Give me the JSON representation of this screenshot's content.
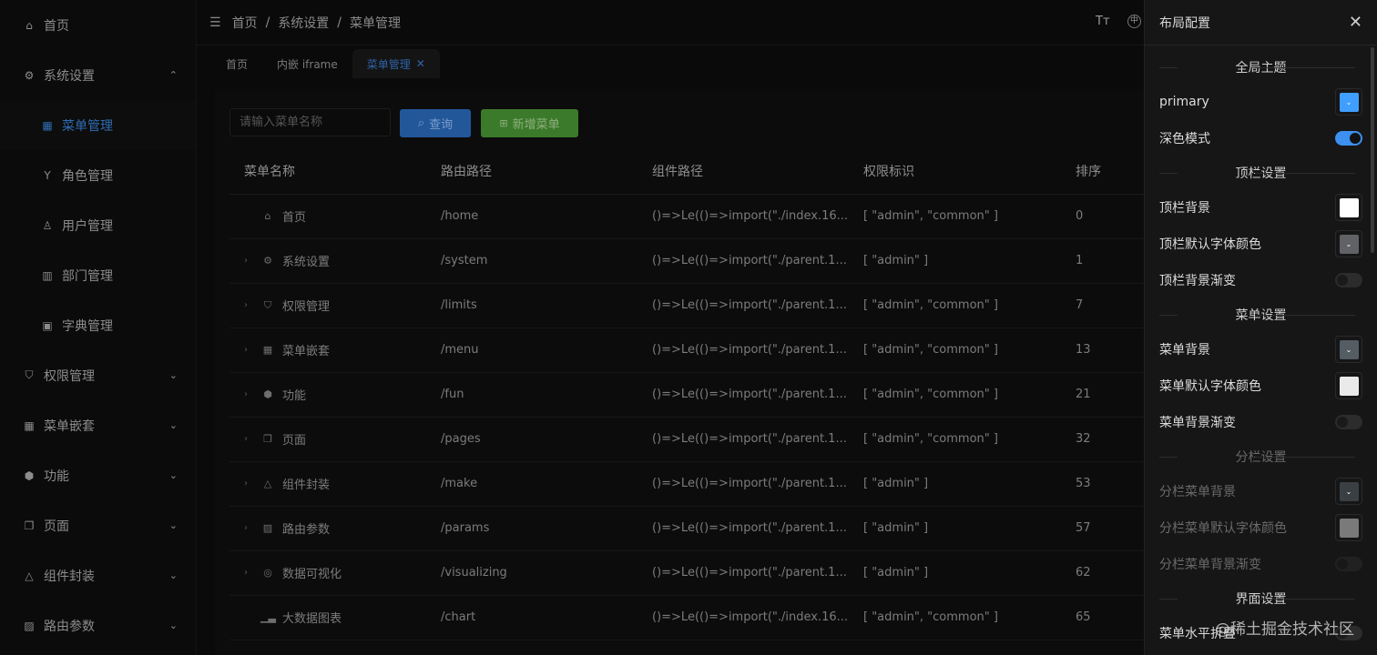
{
  "sidebar": {
    "items": [
      {
        "label": "首页",
        "icon": "home-icon",
        "glyph": "⌂"
      },
      {
        "label": "系统设置",
        "icon": "gear-icon",
        "glyph": "⚙",
        "arrow": "⌃"
      },
      {
        "label": "菜单管理",
        "icon": "grid-icon",
        "glyph": "▦",
        "sub": true,
        "active": true
      },
      {
        "label": "角色管理",
        "icon": "cocktail-icon",
        "glyph": "Y",
        "sub": true
      },
      {
        "label": "用户管理",
        "icon": "user-icon",
        "glyph": "♙",
        "sub": true
      },
      {
        "label": "部门管理",
        "icon": "building-icon",
        "glyph": "▥",
        "sub": true
      },
      {
        "label": "字典管理",
        "icon": "dictionary-icon",
        "glyph": "▣",
        "sub": true
      },
      {
        "label": "权限管理",
        "icon": "shield-icon",
        "glyph": "⛉",
        "arrow": "⌄"
      },
      {
        "label": "菜单嵌套",
        "icon": "grid-icon",
        "glyph": "▦",
        "arrow": "⌄"
      },
      {
        "label": "功能",
        "icon": "cube-icon",
        "glyph": "⬢",
        "arrow": "⌄"
      },
      {
        "label": "页面",
        "icon": "copy-icon",
        "glyph": "❐",
        "arrow": "⌄"
      },
      {
        "label": "组件封装",
        "icon": "shapes-icon",
        "glyph": "△",
        "arrow": "⌄"
      },
      {
        "label": "路由参数",
        "icon": "image-icon",
        "glyph": "▨",
        "arrow": "⌄"
      }
    ]
  },
  "header": {
    "breadcrumb": [
      "首页",
      "系统设置",
      "菜单管理"
    ],
    "separator": "/",
    "menu_icon": "☰",
    "font_icon": "Tт",
    "lang_icon": "中"
  },
  "tabs": [
    {
      "label": "首页"
    },
    {
      "label": "内嵌 iframe"
    },
    {
      "label": "菜单管理",
      "active": true,
      "close": "✕"
    }
  ],
  "toolbar": {
    "search_placeholder": "请输入菜单名称",
    "query_label": "查询",
    "add_label": "新增菜单"
  },
  "table": {
    "columns": [
      "菜单名称",
      "路由路径",
      "组件路径",
      "权限标识",
      "排序"
    ],
    "rows": [
      {
        "name": "首页",
        "icon": "home-icon",
        "glyph": "⌂",
        "expandable": false,
        "path": "/home",
        "component": "()=>Le(()=>import(\"./index.16...",
        "perm": "[ \"admin\", \"common\" ]",
        "order": "0"
      },
      {
        "name": "系统设置",
        "icon": "gear-icon",
        "glyph": "⚙",
        "expandable": true,
        "path": "/system",
        "component": "()=>Le(()=>import(\"./parent.1...",
        "perm": "[ \"admin\" ]",
        "order": "1"
      },
      {
        "name": "权限管理",
        "icon": "shield-icon",
        "glyph": "⛉",
        "expandable": true,
        "path": "/limits",
        "component": "()=>Le(()=>import(\"./parent.1...",
        "perm": "[ \"admin\", \"common\" ]",
        "order": "7"
      },
      {
        "name": "菜单嵌套",
        "icon": "grid-icon",
        "glyph": "▦",
        "expandable": true,
        "path": "/menu",
        "component": "()=>Le(()=>import(\"./parent.1...",
        "perm": "[ \"admin\", \"common\" ]",
        "order": "13"
      },
      {
        "name": "功能",
        "icon": "cube-icon",
        "glyph": "⬢",
        "expandable": true,
        "path": "/fun",
        "component": "()=>Le(()=>import(\"./parent.1...",
        "perm": "[ \"admin\", \"common\" ]",
        "order": "21"
      },
      {
        "name": "页面",
        "icon": "copy-icon",
        "glyph": "❐",
        "expandable": true,
        "path": "/pages",
        "component": "()=>Le(()=>import(\"./parent.1...",
        "perm": "[ \"admin\", \"common\" ]",
        "order": "32"
      },
      {
        "name": "组件封装",
        "icon": "shapes-icon",
        "glyph": "△",
        "expandable": true,
        "path": "/make",
        "component": "()=>Le(()=>import(\"./parent.1...",
        "perm": "[ \"admin\" ]",
        "order": "53"
      },
      {
        "name": "路由参数",
        "icon": "image-icon",
        "glyph": "▨",
        "expandable": true,
        "path": "/params",
        "component": "()=>Le(()=>import(\"./parent.1...",
        "perm": "[ \"admin\" ]",
        "order": "57"
      },
      {
        "name": "数据可视化",
        "icon": "chat-icon",
        "glyph": "◎",
        "expandable": true,
        "path": "/visualizing",
        "component": "()=>Le(()=>import(\"./parent.1...",
        "perm": "[ \"admin\" ]",
        "order": "62"
      },
      {
        "name": "大数据图表",
        "icon": "bar-chart-icon",
        "glyph": "▁▃",
        "expandable": false,
        "path": "/chart",
        "component": "()=>Le(()=>import(\"./index.16...",
        "perm": "[ \"admin\", \"common\" ]",
        "order": "65"
      }
    ]
  },
  "panel": {
    "title": "布局配置",
    "close": "✕",
    "sections": [
      {
        "title": "全局主题",
        "rows": [
          {
            "label": "primary",
            "type": "color",
            "color": "#409eff"
          },
          {
            "label": "深色模式",
            "type": "switch",
            "on": true
          }
        ]
      },
      {
        "title": "顶栏设置",
        "rows": [
          {
            "label": "顶栏背景",
            "type": "color",
            "color": "#ffffff"
          },
          {
            "label": "顶栏默认字体颜色",
            "type": "color",
            "color": "#606266"
          },
          {
            "label": "顶栏背景渐变",
            "type": "switch",
            "on": false
          }
        ]
      },
      {
        "title": "菜单设置",
        "rows": [
          {
            "label": "菜单背景",
            "type": "color",
            "color": "#545c64"
          },
          {
            "label": "菜单默认字体颜色",
            "type": "color",
            "color": "#eaeaea"
          },
          {
            "label": "菜单背景渐变",
            "type": "switch",
            "on": false
          }
        ]
      },
      {
        "title": "分栏设置",
        "dim": true,
        "rows": [
          {
            "label": "分栏菜单背景",
            "type": "color",
            "color": "#3a3f44"
          },
          {
            "label": "分栏菜单默认字体颜色",
            "type": "color",
            "color": "#7a7a7a"
          },
          {
            "label": "分栏菜单背景渐变",
            "type": "switch",
            "on": false
          }
        ]
      },
      {
        "title": "界面设置",
        "rows": [
          {
            "label": "菜单水平折叠",
            "type": "switch",
            "on": false
          }
        ]
      }
    ]
  },
  "watermark": "@稀土掘金技术社区"
}
